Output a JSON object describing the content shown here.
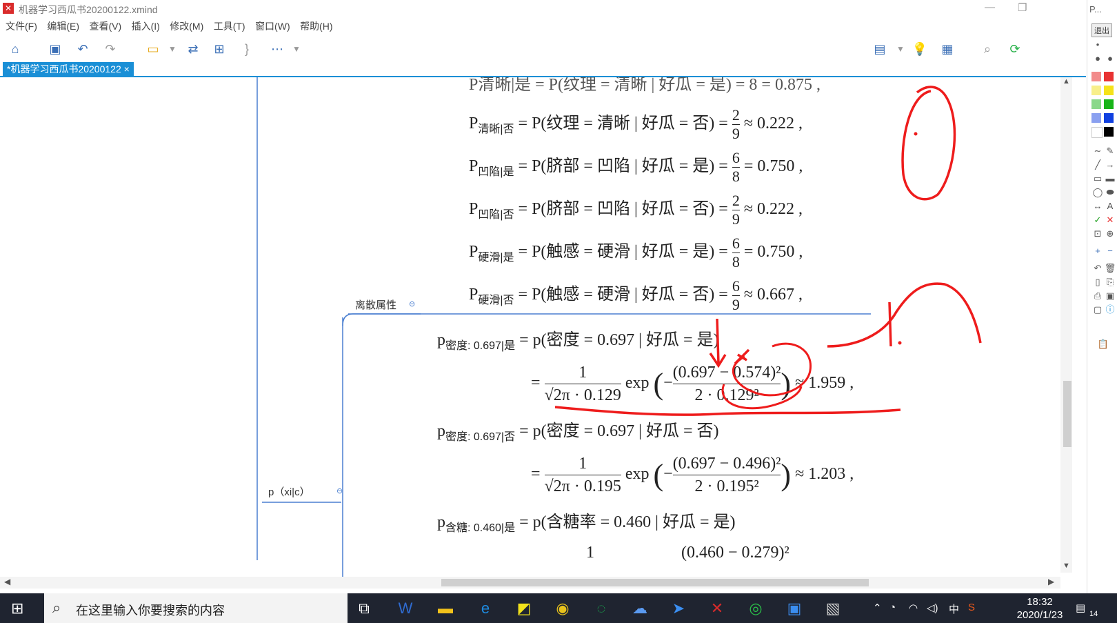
{
  "window": {
    "title": "机器学习西瓜书20200122.xmind",
    "app_icon_glyph": "✕",
    "top_right_label": "P..."
  },
  "menu": [
    "文件(F)",
    "编辑(E)",
    "查看(V)",
    "插入(I)",
    "修改(M)",
    "工具(T)",
    "窗口(W)",
    "帮助(H)"
  ],
  "tab": {
    "label": "*机器学习西瓜书20200122 ×"
  },
  "topics": {
    "discrete": "离散属性",
    "pxc": "p（xi|c）"
  },
  "formulas": {
    "top_partial": "P清晰|是 = P(纹理 = 清晰 | 好瓜 = 是) = 8 = 0.875 ,",
    "rows": [
      {
        "sub": "清晰|否",
        "body": "= P(纹理 = 清晰 | 好瓜 = 否) = ",
        "num": "2",
        "den": "9",
        "approx": "≈ 0.222 ,"
      },
      {
        "sub": "凹陷|是",
        "body": "= P(脐部 = 凹陷 | 好瓜 = 是) = ",
        "num": "6",
        "den": "8",
        "approx": "= 0.750 ,"
      },
      {
        "sub": "凹陷|否",
        "body": "= P(脐部 = 凹陷 | 好瓜 = 否) = ",
        "num": "2",
        "den": "9",
        "approx": "≈ 0.222 ,"
      },
      {
        "sub": "硬滑|是",
        "body": "= P(触感 = 硬滑 | 好瓜 = 是) = ",
        "num": "6",
        "den": "8",
        "approx": "= 0.750 ,"
      },
      {
        "sub": "硬滑|否",
        "body": "= P(触感 = 硬滑 | 好瓜 = 否) = ",
        "num": "6",
        "den": "9",
        "approx": "≈ 0.667 ,"
      }
    ],
    "continuous": [
      {
        "sub": "密度: 0.697|是",
        "eq": "= p(密度 = 0.697 | 好瓜 = 是)",
        "sigma": "√2π · 0.129",
        "expnum": "(0.697 − 0.574)²",
        "expden": "2 · 0.129²",
        "result": "≈ 1.959 ,"
      },
      {
        "sub": "密度: 0.697|否",
        "eq": "= p(密度 = 0.697 | 好瓜 = 否)",
        "sigma": "√2π · 0.195",
        "expnum": "(0.697 − 0.496)²",
        "expden": "2 · 0.195²",
        "result": "≈ 1.203 ,"
      },
      {
        "sub": "含糖: 0.460|是",
        "eq": "= p(含糖率 = 0.460 | 好瓜 = 是)",
        "sigma": "",
        "expnum": "(0.460 − 0.279)²",
        "expden": "",
        "result": ""
      }
    ],
    "one": "1",
    "exp": "exp",
    "eq": "="
  },
  "right_panel": {
    "exit_label": "退出",
    "colors": [
      "#e83232",
      "#f5e21a",
      "#18b418",
      "#1040e0",
      "#ffffff",
      "#000000"
    ]
  },
  "taskbar": {
    "search_placeholder": "在这里输入你要搜索的内容",
    "time": "18:32",
    "date": "2020/1/23",
    "ime": "中",
    "notif_count": "14"
  },
  "icons": {
    "home": "home-icon",
    "save": "save-icon",
    "undo": "undo-icon",
    "redo": "redo-icon"
  }
}
